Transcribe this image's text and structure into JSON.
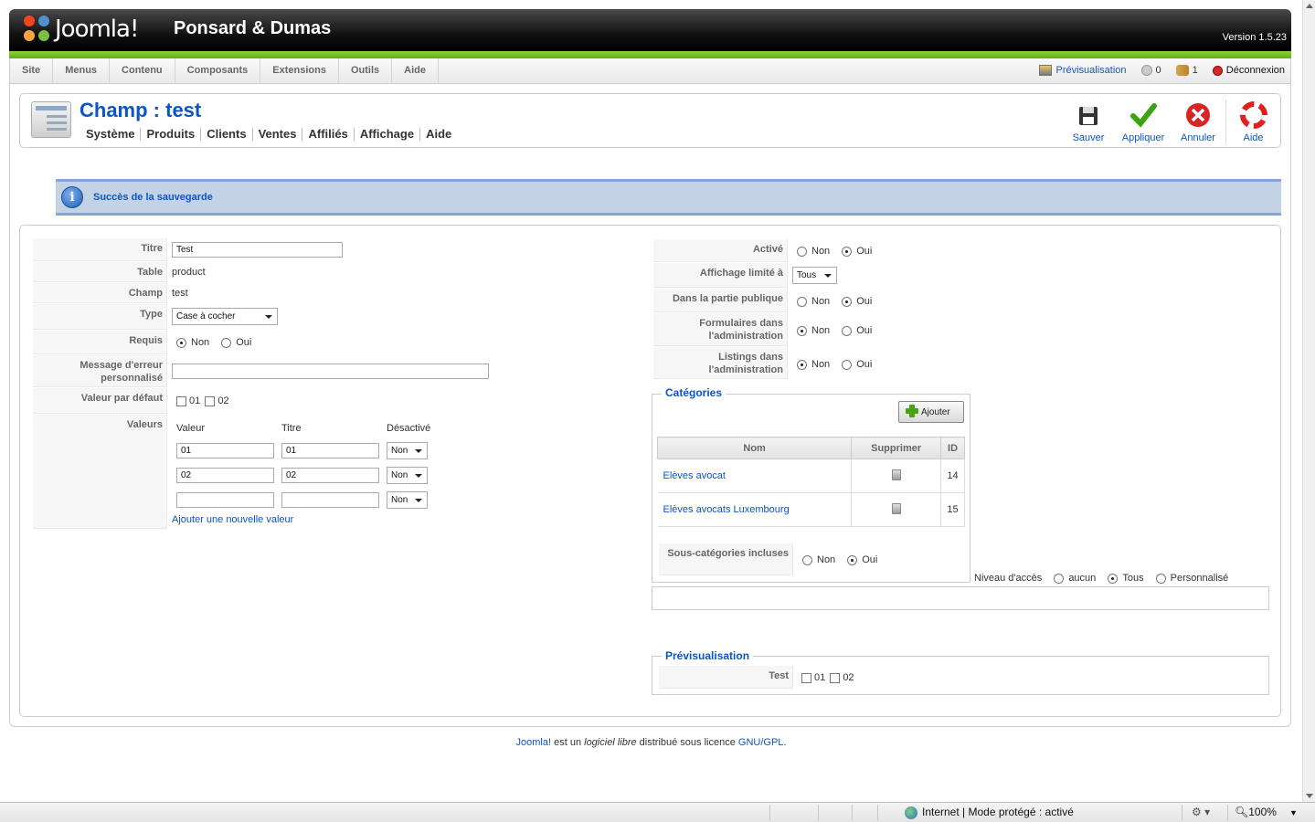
{
  "header": {
    "logo_text": "Joomla!",
    "site_name": "Ponsard & Dumas",
    "version": "Version 1.5.23"
  },
  "menubar": {
    "items": [
      "Site",
      "Menus",
      "Contenu",
      "Composants",
      "Extensions",
      "Outils",
      "Aide"
    ],
    "preview_label": "Prévisualisation",
    "messages_count": "0",
    "users_count": "1",
    "logout_label": "Déconnexion"
  },
  "page": {
    "title": "Champ : test",
    "submenu": [
      "Système",
      "Produits",
      "Clients",
      "Ventes",
      "Affiliés",
      "Affichage",
      "Aide"
    ]
  },
  "toolbar": {
    "save": "Sauver",
    "apply": "Appliquer",
    "cancel": "Annuler",
    "help": "Aide"
  },
  "message": {
    "text": "Succès de la sauvegarde"
  },
  "left": {
    "titre_label": "Titre",
    "titre_value": "Test",
    "table_label": "Table",
    "table_value": "product",
    "champ_label": "Champ",
    "champ_value": "test",
    "type_label": "Type",
    "type_value": "Case à cocher",
    "requis_label": "Requis",
    "non": "Non",
    "oui": "Oui",
    "message_label": "Message d'erreur personnalisé",
    "message_value": "",
    "defaut_label": "Valeur par défaut",
    "defaut_opts": [
      "01",
      "02"
    ],
    "valeurs_label": "Valeurs",
    "col_valeur": "Valeur",
    "col_titre": "Titre",
    "col_desactive": "Désactivé",
    "rows": [
      {
        "valeur": "01",
        "titre": "01",
        "desactive": "Non"
      },
      {
        "valeur": "02",
        "titre": "02",
        "desactive": "Non"
      },
      {
        "valeur": "",
        "titre": "",
        "desactive": "Non"
      }
    ],
    "add_value_link": "Ajouter une nouvelle valeur"
  },
  "right": {
    "active_label": "Activé",
    "affichage_label": "Affichage limité à",
    "affichage_value": "Tous",
    "public_label": "Dans la partie publique",
    "formulaires_label": "Formulaires dans l'administration",
    "listings_label": "Listings dans l'administration",
    "non": "Non",
    "oui": "Oui",
    "categories_legend": "Catégories",
    "add_button": "Ajouter",
    "col_nom": "Nom",
    "col_supprimer": "Supprimer",
    "col_id": "ID",
    "categories": [
      {
        "nom": "Elèves avocat",
        "id": "14"
      },
      {
        "nom": "Elèves avocats Luxembourg",
        "id": "15"
      }
    ],
    "souscat_label": "Sous-catégories incluses",
    "niveau_label": "Niveau d'accès",
    "niveau_opts": [
      "aucun",
      "Tous",
      "Personnalisé"
    ],
    "preview_legend": "Prévisualisation",
    "preview_field": "Test",
    "preview_opts": [
      "01",
      "02"
    ]
  },
  "footer": {
    "joomla": "Joomla!",
    "est_un": " est un ",
    "logiciel": "logiciel libre",
    "distribue": " distribué sous licence ",
    "gpl": "GNU/GPL",
    "dot": "."
  },
  "statusbar": {
    "zone": "Internet | Mode protégé : activé",
    "zoom": "100%"
  },
  "colors": {
    "accent": "#0b55c4",
    "header_green": "#6cbd1e",
    "message_bg": "#c3d2e5"
  }
}
